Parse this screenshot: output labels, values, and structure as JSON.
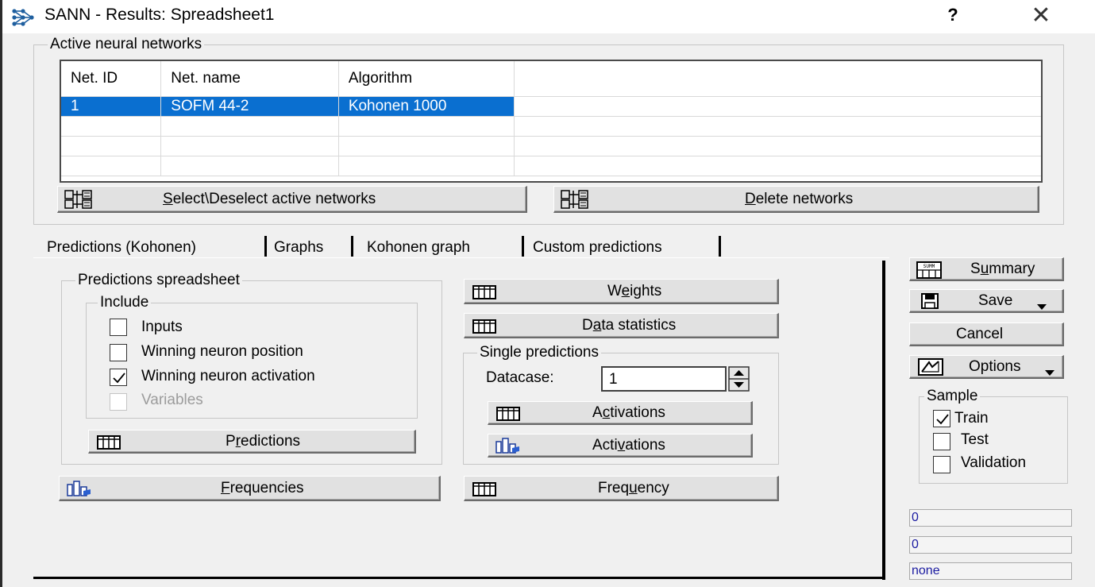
{
  "window": {
    "title": "SANN - Results: Spreadsheet1",
    "help": "?",
    "close": "✕"
  },
  "active_networks": {
    "group_label": "Active neural networks",
    "columns": [
      "Net. ID",
      "Net. name",
      "Algorithm"
    ],
    "rows": [
      [
        "1",
        "SOFM 44-2",
        "Kohonen 1000"
      ],
      [
        "",
        "",
        ""
      ],
      [
        "",
        "",
        ""
      ],
      [
        "",
        "",
        ""
      ]
    ],
    "select_button": {
      "pre": "",
      "key": "S",
      "post": "elect\\Deselect active networks",
      "icon": "network-select-icon"
    },
    "delete_button": {
      "pre": "",
      "key": "D",
      "post": "elete networks",
      "icon": "network-delete-icon"
    }
  },
  "tabs": [
    {
      "label": "Predictions (Kohonen)",
      "active": true
    },
    {
      "label": "Graphs",
      "active": false
    },
    {
      "label": "Kohonen graph",
      "active": false
    },
    {
      "label": "Custom predictions",
      "active": false
    }
  ],
  "predictions_spreadsheet": {
    "group_label": "Predictions spreadsheet",
    "include_label": "Include",
    "checkboxes": [
      {
        "label": "Inputs",
        "checked": false,
        "enabled": true
      },
      {
        "label": "Winning neuron position",
        "checked": false,
        "enabled": true
      },
      {
        "label": "Winning neuron activation",
        "checked": true,
        "enabled": true
      },
      {
        "label": "Variables",
        "checked": false,
        "enabled": false
      }
    ],
    "predictions_button": {
      "pre": "P",
      "key": "r",
      "post": "edictions",
      "icon": "spreadsheet-icon"
    }
  },
  "frequencies_button": {
    "pre": "",
    "key": "F",
    "post": "requencies",
    "icon": "histogram-icon"
  },
  "weights_button": {
    "pre": "W",
    "key": "e",
    "post": "ights",
    "icon": "spreadsheet-icon"
  },
  "data_statistics_button": {
    "pre": "D",
    "key": "a",
    "post": "ta statistics",
    "icon": "spreadsheet-icon"
  },
  "single_predictions": {
    "group_label": "Single predictions",
    "datacase_label": "Datacase:",
    "datacase_value": "1",
    "activations_sheet_button": {
      "pre": "A",
      "key": "c",
      "post": "tivations",
      "icon": "spreadsheet-icon"
    },
    "activations_graph_button": {
      "pre": "Acti",
      "key": "v",
      "post": "ations",
      "icon": "histogram-icon"
    }
  },
  "frequency_button": {
    "pre": "Freq",
    "key": "u",
    "post": "ency",
    "icon": "spreadsheet-icon"
  },
  "side": {
    "summary_button": {
      "pre": "S",
      "key": "u",
      "post": "mmary",
      "icon": "summary-icon",
      "icon_text": "SUMM"
    },
    "save_button": {
      "label": "Save",
      "icon": "floppy-disk-icon"
    },
    "cancel_button": {
      "label": "Cancel"
    },
    "options_button": {
      "label": "Options",
      "icon": "options-icon"
    },
    "sample": {
      "group_label": "Sample",
      "checkboxes": [
        {
          "label": "Train",
          "checked": true
        },
        {
          "label": "Test",
          "checked": false
        },
        {
          "label": "Validation",
          "checked": false
        }
      ]
    },
    "status": [
      "0",
      "0",
      "none"
    ]
  }
}
